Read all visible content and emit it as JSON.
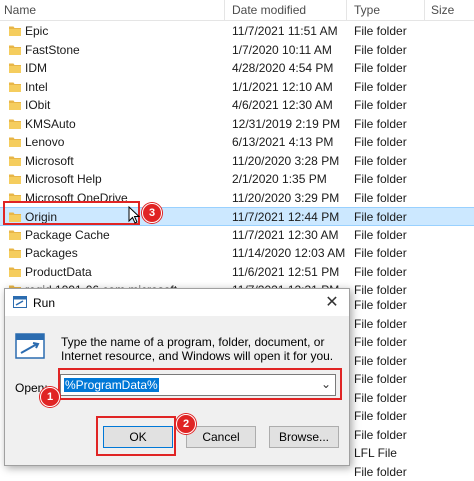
{
  "explorer": {
    "columns": {
      "name": "Name",
      "date": "Date modified",
      "type": "Type",
      "size": "Size"
    },
    "rows": [
      {
        "name": "Epic",
        "date": "11/7/2021 11:51 AM",
        "type": "File folder"
      },
      {
        "name": "FastStone",
        "date": "1/7/2020 10:11 AM",
        "type": "File folder"
      },
      {
        "name": "IDM",
        "date": "4/28/2020 4:54 PM",
        "type": "File folder"
      },
      {
        "name": "Intel",
        "date": "1/1/2021 12:10 AM",
        "type": "File folder"
      },
      {
        "name": "IObit",
        "date": "4/6/2021 12:30 AM",
        "type": "File folder"
      },
      {
        "name": "KMSAuto",
        "date": "12/31/2019 2:19 PM",
        "type": "File folder"
      },
      {
        "name": "Lenovo",
        "date": "6/13/2021 4:13 PM",
        "type": "File folder"
      },
      {
        "name": "Microsoft",
        "date": "11/20/2020 3:28 PM",
        "type": "File folder"
      },
      {
        "name": "Microsoft Help",
        "date": "2/1/2020 1:35 PM",
        "type": "File folder"
      },
      {
        "name": "Microsoft OneDrive",
        "date": "11/20/2020 3:29 PM",
        "type": "File folder"
      },
      {
        "name": "Origin",
        "date": "11/7/2021 12:44 PM",
        "type": "File folder"
      },
      {
        "name": "Package Cache",
        "date": "11/7/2021 12:30 AM",
        "type": "File folder"
      },
      {
        "name": "Packages",
        "date": "11/14/2020 12:03 AM",
        "type": "File folder"
      },
      {
        "name": "ProductData",
        "date": "11/6/2021 12:51 PM",
        "type": "File folder"
      },
      {
        "name": "regid.1991-06.com.microsoft",
        "date": "11/7/2021 12:31 PM",
        "type": "File folder"
      }
    ],
    "partial_types": [
      "File folder",
      "File folder",
      "File folder",
      "File folder",
      "File folder",
      "File folder",
      "File folder",
      "File folder",
      "LFL File",
      "File folder"
    ]
  },
  "run_dialog": {
    "title": "Run",
    "close_glyph": "✕",
    "description": "Type the name of a program, folder, document, or Internet resource, and Windows will open it for you.",
    "open_label": "Open:",
    "open_value": "%ProgramData%",
    "ok_label": "OK",
    "cancel_label": "Cancel",
    "browse_label": "Browse...",
    "dropdown_glyph": "⌄"
  },
  "callouts": {
    "step1": "1",
    "step2": "2",
    "step3": "3"
  },
  "colors": {
    "accent": "#0078d7",
    "highlight": "#e02424",
    "selection": "#cce8ff",
    "folder": "#e8b647"
  }
}
